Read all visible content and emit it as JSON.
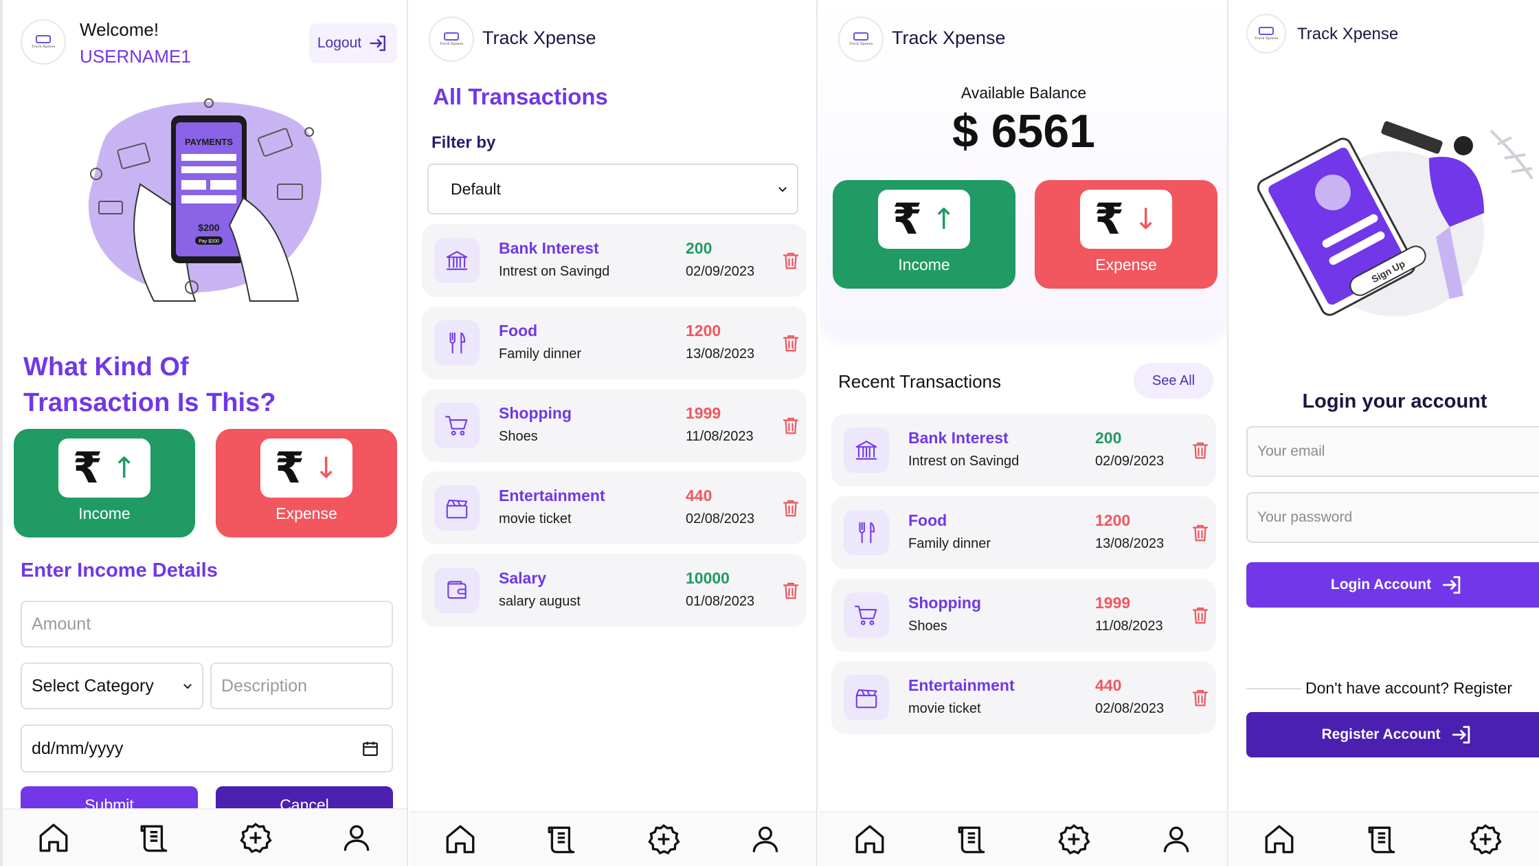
{
  "colors": {
    "purple": "#7137e8",
    "dark_purple": "#4b1fb0",
    "green": "#1f9b63",
    "red": "#f2565e"
  },
  "logo_text": "Track Xpense",
  "add_screen": {
    "welcome": "Welcome!",
    "username": "USERNAME1",
    "logout_label": "Logout",
    "illustration": {
      "heading": "PAYMENTS",
      "amount": "$200",
      "pay_label": "Pay $200"
    },
    "question_line1": "What Kind Of",
    "question_line2": "Transaction Is This?",
    "income_label": "Income",
    "expense_label": "Expense",
    "rupee": "₹",
    "up_arrow": "↑",
    "down_arrow": "↓",
    "details_title": "Enter Income Details",
    "amount_placeholder": "Amount",
    "category_value": "Select Category",
    "description_placeholder": "Description",
    "date_placeholder": "dd/mm/yyyy",
    "submit_label": "Submit",
    "cancel_label": "Cancel"
  },
  "all_transactions": {
    "brand": "Track Xpense",
    "title": "All Transactions",
    "filter_label": "Filter by",
    "filter_value": "Default",
    "items": [
      {
        "title": "Bank Interest",
        "desc": "Intrest on Savingd",
        "amount": "200",
        "date": "02/09/2023",
        "type": "income",
        "icon": "bank-icon"
      },
      {
        "title": "Food",
        "desc": "Family dinner",
        "amount": "1200",
        "date": "13/08/2023",
        "type": "expense",
        "icon": "cutlery-icon"
      },
      {
        "title": "Shopping",
        "desc": "Shoes",
        "amount": "1999",
        "date": "11/08/2023",
        "type": "expense",
        "icon": "cart-icon"
      },
      {
        "title": "Entertainment",
        "desc": "movie ticket",
        "amount": "440",
        "date": "02/08/2023",
        "type": "expense",
        "icon": "clapper-icon"
      },
      {
        "title": "Salary",
        "desc": "salary august",
        "amount": "10000",
        "date": "01/08/2023",
        "type": "income",
        "icon": "wallet-icon"
      }
    ]
  },
  "home": {
    "brand": "Track Xpense",
    "balance_label": "Available Balance",
    "balance_value": "$ 6561",
    "income_label": "Income",
    "expense_label": "Expense",
    "recent_title": "Recent Transactions",
    "see_all_label": "See All",
    "items": [
      {
        "title": "Bank Interest",
        "desc": "Intrest on Savingd",
        "amount": "200",
        "date": "02/09/2023",
        "type": "income",
        "icon": "bank-icon"
      },
      {
        "title": "Food",
        "desc": "Family dinner",
        "amount": "1200",
        "date": "13/08/2023",
        "type": "expense",
        "icon": "cutlery-icon"
      },
      {
        "title": "Shopping",
        "desc": "Shoes",
        "amount": "1999",
        "date": "11/08/2023",
        "type": "expense",
        "icon": "cart-icon"
      },
      {
        "title": "Entertainment",
        "desc": "movie ticket",
        "amount": "440",
        "date": "02/08/2023",
        "type": "expense",
        "icon": "clapper-icon"
      }
    ]
  },
  "login": {
    "brand": "Track Xpense",
    "illustration_badge": "Sign Up",
    "title": "Login your account",
    "email_placeholder": "Your email",
    "password_placeholder": "Your password",
    "login_label": "Login Account",
    "register_prompt": "Don't have account? Register",
    "register_label": "Register Account"
  },
  "nav_icons": [
    "home-icon",
    "transactions-icon",
    "add-icon",
    "profile-icon"
  ]
}
